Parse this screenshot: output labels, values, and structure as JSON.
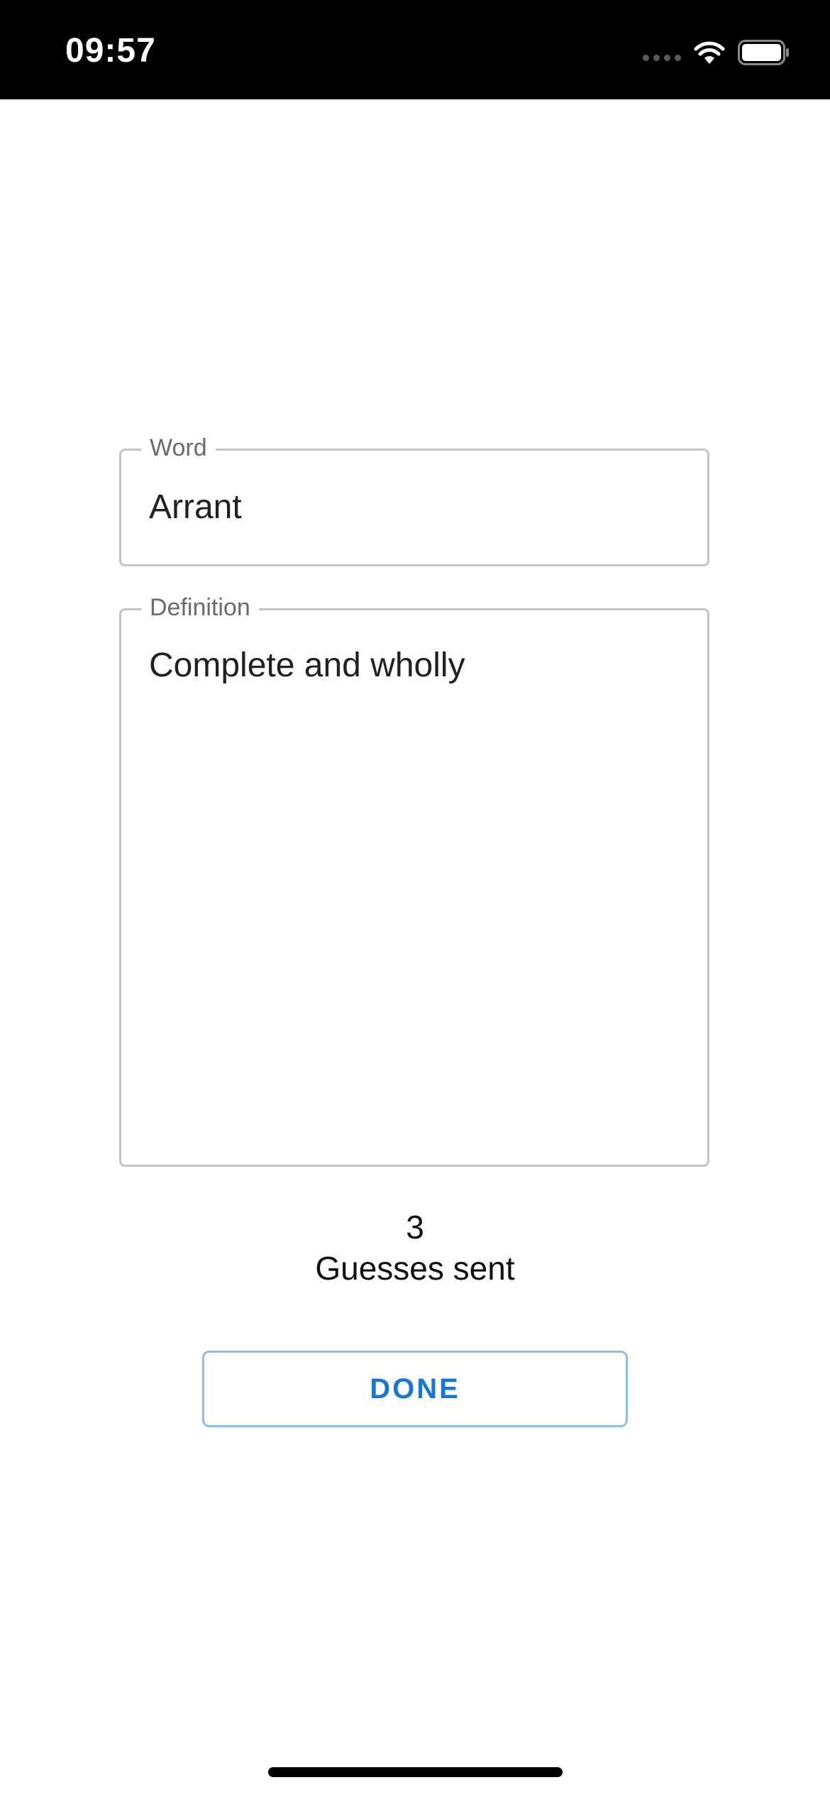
{
  "status_bar": {
    "time": "09:57",
    "icons": [
      "cellular-signal-icon",
      "wifi-icon",
      "battery-icon"
    ]
  },
  "form": {
    "word": {
      "label": "Word",
      "value": "Arrant"
    },
    "definition": {
      "label": "Definition",
      "value": "Complete and wholly"
    }
  },
  "guesses": {
    "count": "3",
    "label": "Guesses sent"
  },
  "actions": {
    "done_label": "DONE"
  },
  "colors": {
    "accent": "#1976d2",
    "field_border": "#c4c4c4",
    "status_bar_bg": "#000000"
  }
}
